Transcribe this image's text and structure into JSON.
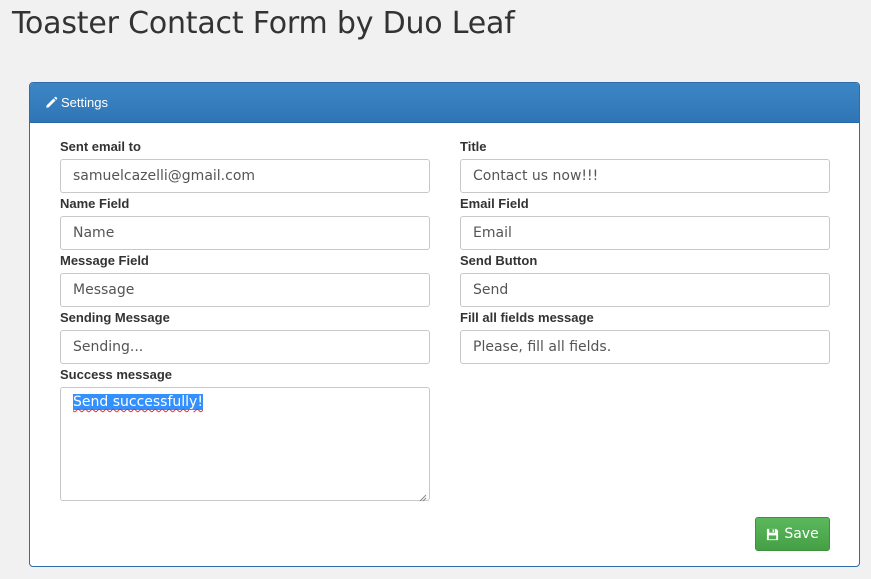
{
  "page": {
    "title": "Toaster Contact Form by Duo Leaf"
  },
  "panel": {
    "heading": "Settings",
    "heading_icon": "pencil-icon"
  },
  "fields": {
    "sent_email_to": {
      "label": "Sent email to",
      "value": "samuelcazelli@gmail.com"
    },
    "title": {
      "label": "Title",
      "value": "Contact us now!!!"
    },
    "name_field": {
      "label": "Name Field",
      "value": "Name"
    },
    "email_field": {
      "label": "Email Field",
      "value": "Email"
    },
    "message_field": {
      "label": "Message Field",
      "value": "Message"
    },
    "send_button": {
      "label": "Send Button",
      "value": "Send"
    },
    "sending_message": {
      "label": "Sending Message",
      "value": "Sending..."
    },
    "fill_all_fields_message": {
      "label": "Fill all fields message",
      "value": "Please, fill all fields."
    },
    "success_message": {
      "label": "Success message",
      "value": "Send successfully!"
    }
  },
  "actions": {
    "save_label": "Save",
    "save_icon": "floppy-disk-icon"
  },
  "colors": {
    "panel_heading": "#337ab7",
    "save_button": "#5cb85c",
    "selection": "#3390ff"
  }
}
